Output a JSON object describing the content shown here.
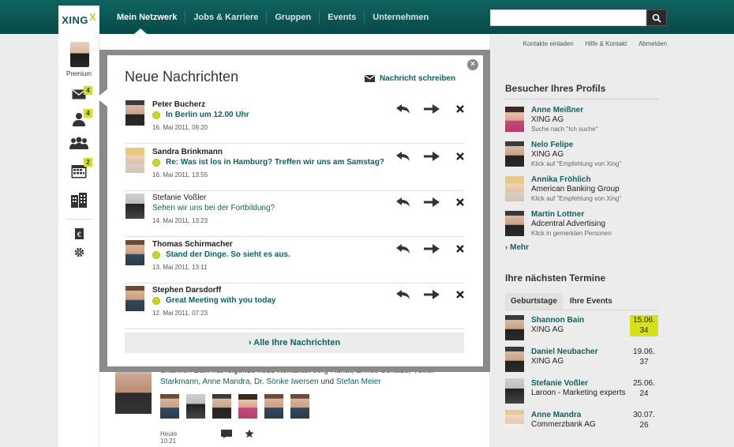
{
  "brand": {
    "logo_text": "XING",
    "logo_mark": "X"
  },
  "nav": {
    "items": [
      "Mein Netzwerk",
      "Jobs & Karriere",
      "Gruppen",
      "Events",
      "Unternehmen"
    ]
  },
  "search": {
    "value": "",
    "placeholder": ""
  },
  "utility": {
    "invite": "Kontakte einladen",
    "help": "Hilfe & Kontakt",
    "logout": "Abmelden",
    "sep": "·"
  },
  "left_sidebar": {
    "membership": "Premium",
    "messages_badge": "4",
    "contacts_badge": "4",
    "calendar_badge": "2"
  },
  "panel": {
    "title": "Neue Nachrichten",
    "compose_label": "Nachricht schreiben",
    "close_label": "×",
    "all_messages_label": "› Alle Ihre Nachrichten",
    "messages": [
      {
        "from": "Peter Bucherz",
        "subject": "In Berlin um 12.00 Uhr",
        "date": "16. Mai 2011, 09:20",
        "unread": true
      },
      {
        "from": "Sandra Brinkmann",
        "subject": "Re: Was ist los in Hamburg? Treffen wir uns am Samstag?",
        "date": "16. Mai 2011, 13:55",
        "unread": true
      },
      {
        "from": "Stefanie Voßler",
        "subject": "Sehen wir uns bei der Fortbildung?",
        "date": "14. Mai 2011, 13:23",
        "unread": false
      },
      {
        "from": "Thomas Schirmacher",
        "subject": "Stand der Dinge. So sieht es aus.",
        "date": "13. Mai 2011, 13:11",
        "unread": true
      },
      {
        "from": "Stephen Darsdorff",
        "subject": "Great Meeting with you today",
        "date": "12. Mai 2011, 07:23",
        "unread": true
      }
    ]
  },
  "visitors": {
    "title": "Besucher Ihres Profils",
    "items": [
      {
        "name": "Anne Meißner",
        "company": "XING AG",
        "hint": "Suche nach \"Ich suche\""
      },
      {
        "name": "Nelo Felipe",
        "company": "XING AG",
        "hint": "Klick auf \"Empfehlung von Xing\""
      },
      {
        "name": "Annika Fröhlich",
        "company": "American Banking Group",
        "hint": "Klick auf \"Empfehlung von Xing\""
      },
      {
        "name": "Martin Lottner",
        "company": "Adcentral Advertising",
        "hint": "Klick in gemerkten Personen"
      }
    ],
    "more_label": "› Mehr"
  },
  "events": {
    "title": "Ihre nächsten Termine",
    "tabs": [
      "Geburtstage",
      "Ihre Events"
    ],
    "items": [
      {
        "name": "Shannon Bain",
        "company": "XING AG",
        "date_line1": "15.06.",
        "date_line2": "34",
        "highlight": true
      },
      {
        "name": "Daniel Neubacher",
        "company": "XING AG",
        "date_line1": "19.06.",
        "date_line2": "37",
        "highlight": false
      },
      {
        "name": "Stefanie Voßler",
        "company": "Laroon - Marketing experts",
        "date_line1": "25.06.",
        "date_line2": "24",
        "highlight": false
      },
      {
        "name": "Anne Mandra",
        "company": "Commerzbank AG",
        "date_line1": "30.07.",
        "date_line2": "26",
        "highlight": false
      }
    ]
  },
  "activity": {
    "actor": "Shannon Bain",
    "verb": " hat folgende neue Kontakte: ",
    "contacts_a": "Jörg Hundt, Enrico Schulze, Volker Starkmann, Anne Mandra, Dr. Sönke Iwersen",
    "conj": " und ",
    "contacts_b": "Stefan Meier",
    "time": "Heute 10:21"
  },
  "colors": {
    "brand_teal": "#0a6462",
    "accent_lime": "#cfe02a"
  }
}
